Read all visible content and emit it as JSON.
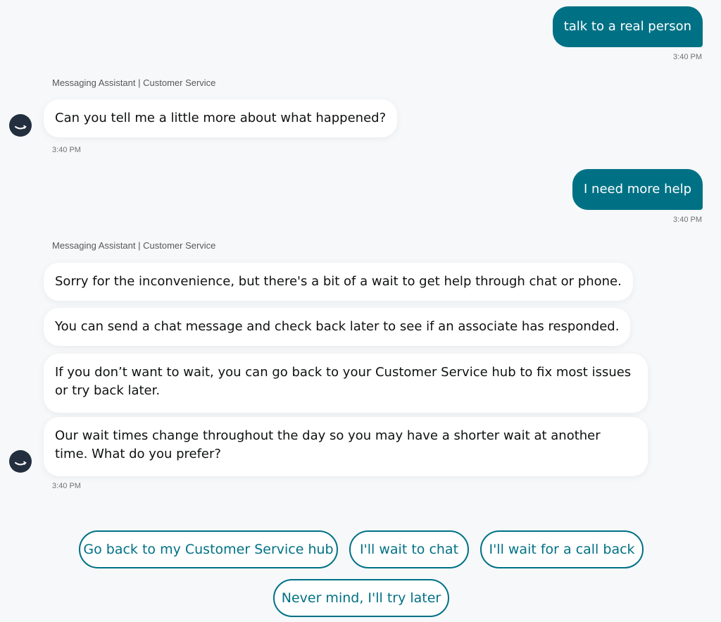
{
  "messages": {
    "user1": {
      "text": "talk to a real person",
      "time": "3:40 PM"
    },
    "bot1": {
      "sender": "Messaging Assistant | Customer Service",
      "text": "Can you tell me a little more about what happened?",
      "time": "3:40 PM"
    },
    "user2": {
      "text": "I need more help",
      "time": "3:40 PM"
    },
    "bot2": {
      "sender": "Messaging Assistant | Customer Service",
      "lines": [
        "Sorry for the inconvenience, but there's a bit of a wait to get help through chat or phone.",
        "You can send a chat message and check back later to see if an associate has responded.",
        "If you don’t want to wait, you can go back to your Customer Service hub to fix most issues or try back later.",
        "Our wait times change throughout the day so you may have a shorter wait at another time. What do you prefer?"
      ],
      "time": "3:40 PM"
    }
  },
  "quick_replies": [
    "Go back to my Customer Service hub",
    "I'll wait to chat",
    "I'll wait for a call back",
    "Never mind, I'll try later"
  ],
  "colors": {
    "accent": "#007185",
    "background": "#f6f8fa",
    "bot_bubble": "#ffffff",
    "avatar": "#232f3e"
  },
  "icons": {
    "avatar": "assistant-smile-icon"
  }
}
